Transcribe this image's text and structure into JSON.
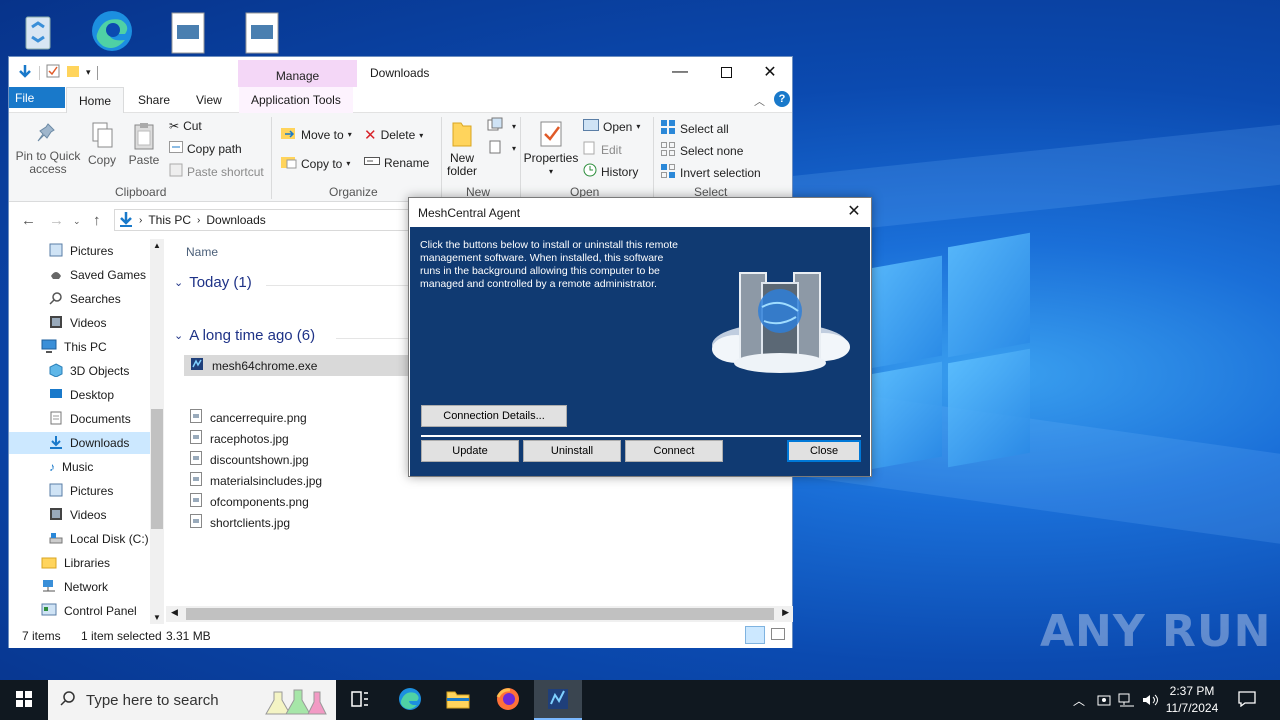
{
  "explorer": {
    "title": "Downloads",
    "manage_tab": "Manage",
    "tabs": {
      "file": "File",
      "home": "Home",
      "share": "Share",
      "view": "View",
      "app_tools": "Application Tools"
    },
    "ribbon": {
      "pin": "Pin to Quick access",
      "copy": "Copy",
      "paste": "Paste",
      "cut": "Cut",
      "copy_path": "Copy path",
      "paste_shortcut": "Paste shortcut",
      "clipboard": "Clipboard",
      "move_to": "Move to",
      "copy_to": "Copy to",
      "delete": "Delete",
      "rename": "Rename",
      "organize": "Organize",
      "new_folder": "New folder",
      "new": "New",
      "properties": "Properties",
      "open_btn": "Open",
      "edit": "Edit",
      "history": "History",
      "open_group": "Open",
      "select_all": "Select all",
      "select_none": "Select none",
      "invert": "Invert selection",
      "select_group": "Select"
    },
    "address": {
      "this_pc": "This PC",
      "downloads": "Downloads"
    },
    "nav": [
      "Pictures",
      "Saved Games",
      "Searches",
      "Videos",
      "This PC",
      "3D Objects",
      "Desktop",
      "Documents",
      "Downloads",
      "Music",
      "Pictures",
      "Videos",
      "Local Disk (C:)",
      "Libraries",
      "Network",
      "Control Panel"
    ],
    "column_name": "Name",
    "groups": {
      "today": "Today (1)",
      "long_ago": "A long time ago (6)"
    },
    "files_today": [
      "mesh64chrome.exe"
    ],
    "files_old": [
      "cancerrequire.png",
      "racephotos.jpg",
      "discountshown.jpg",
      "materialsincludes.jpg",
      "ofcomponents.png",
      "shortclients.jpg"
    ],
    "status": {
      "items": "7 items",
      "selected": "1 item selected",
      "size": "3.31 MB"
    }
  },
  "mesh": {
    "title": "MeshCentral Agent",
    "description": "Click the buttons below to install or uninstall this remote management software. When installed, this software runs in the background allowing this computer to be managed and controlled by a remote administrator.",
    "connection_details": "Connection Details...",
    "update": "Update",
    "uninstall": "Uninstall",
    "connect": "Connect",
    "close": "Close"
  },
  "taskbar": {
    "search_placeholder": "Type here to search",
    "time": "2:37 PM",
    "date": "11/7/2024"
  },
  "watermark": "ANY RUN",
  "colors": {
    "accent": "#1979ca",
    "mesh_bg": "#103a72",
    "selection": "#cce8ff"
  }
}
